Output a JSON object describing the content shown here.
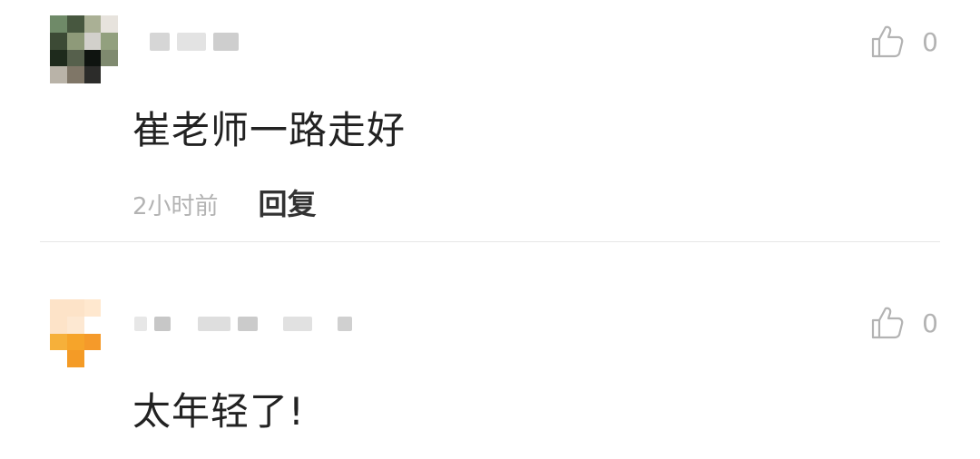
{
  "comments": [
    {
      "text": "崔老师一路走好",
      "time": "2小时前",
      "reply_label": "回复",
      "like_count": "0",
      "avatar_colors": [
        "#6f8a68",
        "#47573f",
        "#aab095",
        "#e7e3dd",
        "#3c4a35",
        "#8e9a79",
        "#d2d0cb",
        "#92a07e",
        "#1e2a1c",
        "#56604c",
        "#0f1410",
        "#7f8a6f",
        "#b9b3a8",
        "#7f7667",
        "#2c2c2a",
        "#ffffff"
      ]
    },
    {
      "text": "太年轻了!",
      "like_count": "0",
      "avatar_colors": [
        "#fde3c8",
        "#fde3c8",
        "#ffe8cf",
        "#ffffff",
        "#fde3c8",
        "#fde8d2",
        "#ffffff",
        "#ffffff",
        "#f6b03a",
        "#f6a42a",
        "#f59a2a",
        "#ffffff",
        "#ffffff",
        "#f49b26",
        "#ffffff",
        "#ffffff"
      ]
    }
  ],
  "icons": {
    "like": "thumbs-up-icon"
  },
  "colors": {
    "muted": "#b3b3b3",
    "text": "#222222",
    "divider": "#e6e6e6"
  }
}
